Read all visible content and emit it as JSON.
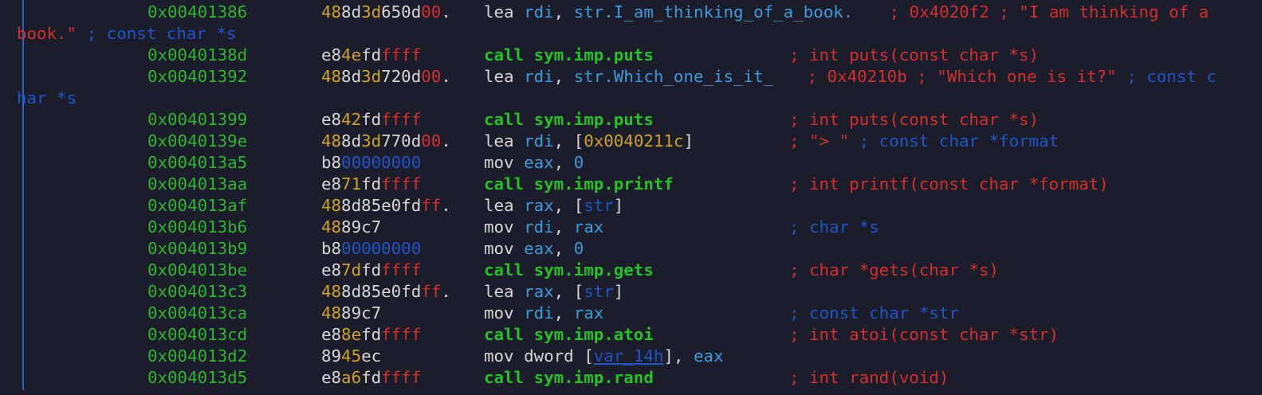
{
  "colors": {
    "background": "#1c1d2a",
    "address": "#2fb52f",
    "call": "#28c028",
    "comment": "#d3302f",
    "register": "#3f9bdc",
    "type_keyword": "#1f55c9",
    "byte_yellow": "#cfa22a",
    "gutter": "#2a63c6"
  },
  "lines": [
    {
      "addr": "0x00401386",
      "bytes": [
        [
          "48",
          "yellow"
        ],
        [
          "8d",
          "white"
        ],
        [
          "3d",
          "yellow"
        ],
        [
          "650d",
          "white"
        ],
        [
          "00",
          "red"
        ],
        [
          ".",
          "white"
        ]
      ],
      "ins": [
        [
          "lea ",
          "white"
        ],
        [
          "rdi",
          "blue"
        ],
        [
          ", ",
          "white"
        ],
        [
          "str.I_am_thinking_of_a_book.",
          "blue"
        ]
      ],
      "cmt": [
        [
          " ; 0x4020f2 ; \"I am thinking of a",
          "red"
        ]
      ]
    },
    {
      "cont": [
        [
          "book.\"",
          "red"
        ],
        [
          " ; const char *s",
          "dblue"
        ]
      ]
    },
    {
      "addr": "0x0040138d",
      "bytes": [
        [
          "e8",
          "white"
        ],
        [
          "4e",
          "yellow"
        ],
        [
          "fd",
          "white"
        ],
        [
          "ffff",
          "red"
        ]
      ],
      "ins": [
        [
          "call sym.imp.puts",
          "green"
        ]
      ],
      "cmt": [
        [
          "; int puts(const char *s)",
          "red"
        ]
      ]
    },
    {
      "addr": "0x00401392",
      "bytes": [
        [
          "48",
          "yellow"
        ],
        [
          "8d",
          "white"
        ],
        [
          "3d",
          "yellow"
        ],
        [
          "720d",
          "white"
        ],
        [
          "00",
          "red"
        ],
        [
          ".",
          "white"
        ]
      ],
      "ins": [
        [
          "lea ",
          "white"
        ],
        [
          "rdi",
          "blue"
        ],
        [
          ", ",
          "white"
        ],
        [
          "str.Which_one_is_it_",
          "blue"
        ]
      ],
      "cmt": [
        [
          " ; 0x40210b ; \"Which one is it?\"",
          "red"
        ],
        [
          " ; const c",
          "dblue"
        ]
      ]
    },
    {
      "cont": [
        [
          "har *s",
          "dblue"
        ]
      ]
    },
    {
      "addr": "0x00401399",
      "bytes": [
        [
          "e8",
          "white"
        ],
        [
          "42",
          "yellow"
        ],
        [
          "fd",
          "white"
        ],
        [
          "ffff",
          "red"
        ]
      ],
      "ins": [
        [
          "call sym.imp.puts",
          "green"
        ]
      ],
      "cmt": [
        [
          "; int puts(const char *s)",
          "red"
        ]
      ]
    },
    {
      "addr": "0x0040139e",
      "bytes": [
        [
          "48",
          "yellow"
        ],
        [
          "8d",
          "white"
        ],
        [
          "3d",
          "yellow"
        ],
        [
          "770d",
          "white"
        ],
        [
          "00",
          "red"
        ],
        [
          ".",
          "white"
        ]
      ],
      "ins": [
        [
          "lea ",
          "white"
        ],
        [
          "rdi",
          "blue"
        ],
        [
          ", [",
          "white"
        ],
        [
          "0x0040211c",
          "yellow"
        ],
        [
          "]",
          "white"
        ]
      ],
      "cmt": [
        [
          "; \"> \"",
          "red"
        ],
        [
          " ; const char *format",
          "dblue"
        ]
      ]
    },
    {
      "addr": "0x004013a5",
      "bytes": [
        [
          "b8",
          "white"
        ],
        [
          "00000000",
          "dblue"
        ]
      ],
      "ins": [
        [
          "mov ",
          "white"
        ],
        [
          "eax",
          "blue"
        ],
        [
          ", ",
          "white"
        ],
        [
          "0",
          "blue"
        ]
      ],
      "cmt": []
    },
    {
      "addr": "0x004013aa",
      "bytes": [
        [
          "e8",
          "white"
        ],
        [
          "71",
          "yellow"
        ],
        [
          "fd",
          "white"
        ],
        [
          "ffff",
          "red"
        ]
      ],
      "ins": [
        [
          "call sym.imp.printf",
          "green"
        ]
      ],
      "cmt": [
        [
          "; int printf(const char *format)",
          "red"
        ]
      ]
    },
    {
      "addr": "0x004013af",
      "bytes": [
        [
          "48",
          "yellow"
        ],
        [
          "8d85e0fd",
          "white"
        ],
        [
          "ff",
          "red"
        ],
        [
          ".",
          "white"
        ]
      ],
      "ins": [
        [
          "lea ",
          "white"
        ],
        [
          "rax",
          "blue"
        ],
        [
          ", [",
          "white"
        ],
        [
          "str",
          "dblue"
        ],
        [
          "]",
          "white"
        ]
      ],
      "cmt": []
    },
    {
      "addr": "0x004013b6",
      "bytes": [
        [
          "48",
          "yellow"
        ],
        [
          "89c7",
          "white"
        ]
      ],
      "ins": [
        [
          "mov ",
          "white"
        ],
        [
          "rdi",
          "blue"
        ],
        [
          ", ",
          "white"
        ],
        [
          "rax",
          "blue"
        ]
      ],
      "cmt": [
        [
          "; char *s",
          "dblue"
        ]
      ]
    },
    {
      "addr": "0x004013b9",
      "bytes": [
        [
          "b8",
          "white"
        ],
        [
          "00000000",
          "dblue"
        ]
      ],
      "ins": [
        [
          "mov ",
          "white"
        ],
        [
          "eax",
          "blue"
        ],
        [
          ", ",
          "white"
        ],
        [
          "0",
          "blue"
        ]
      ],
      "cmt": []
    },
    {
      "addr": "0x004013be",
      "bytes": [
        [
          "e8",
          "white"
        ],
        [
          "7d",
          "yellow"
        ],
        [
          "fd",
          "white"
        ],
        [
          "ffff",
          "red"
        ]
      ],
      "ins": [
        [
          "call sym.imp.gets",
          "green"
        ]
      ],
      "cmt": [
        [
          "; char *gets(char *s)",
          "red"
        ]
      ]
    },
    {
      "addr": "0x004013c3",
      "bytes": [
        [
          "48",
          "yellow"
        ],
        [
          "8d85e0fd",
          "white"
        ],
        [
          "ff",
          "red"
        ],
        [
          ".",
          "white"
        ]
      ],
      "ins": [
        [
          "lea ",
          "white"
        ],
        [
          "rax",
          "blue"
        ],
        [
          ", [",
          "white"
        ],
        [
          "str",
          "dblue"
        ],
        [
          "]",
          "white"
        ]
      ],
      "cmt": []
    },
    {
      "addr": "0x004013ca",
      "bytes": [
        [
          "48",
          "yellow"
        ],
        [
          "89c7",
          "white"
        ]
      ],
      "ins": [
        [
          "mov ",
          "white"
        ],
        [
          "rdi",
          "blue"
        ],
        [
          ", ",
          "white"
        ],
        [
          "rax",
          "blue"
        ]
      ],
      "cmt": [
        [
          "; const char *str",
          "dblue"
        ]
      ]
    },
    {
      "addr": "0x004013cd",
      "bytes": [
        [
          "e8",
          "white"
        ],
        [
          "8e",
          "yellow"
        ],
        [
          "fd",
          "white"
        ],
        [
          "ffff",
          "red"
        ]
      ],
      "ins": [
        [
          "call sym.imp.atoi",
          "green"
        ]
      ],
      "cmt": [
        [
          "; int atoi(const char *str)",
          "red"
        ]
      ]
    },
    {
      "addr": "0x004013d2",
      "bytes": [
        [
          "89",
          "white"
        ],
        [
          "45",
          "yellow"
        ],
        [
          "ec",
          "white"
        ]
      ],
      "ins": [
        [
          "mov dword [",
          "white"
        ],
        [
          "var_14h",
          "dblue-u"
        ],
        [
          "], ",
          "white"
        ],
        [
          "eax",
          "blue"
        ]
      ],
      "cmt": []
    },
    {
      "addr": "0x004013d5",
      "bytes": [
        [
          "e8",
          "white"
        ],
        [
          "a6",
          "yellow"
        ],
        [
          "fd",
          "white"
        ],
        [
          "ffff",
          "red"
        ]
      ],
      "ins": [
        [
          "call sym.imp.rand",
          "green"
        ]
      ],
      "cmt": [
        [
          "; int rand(void)",
          "red"
        ]
      ]
    }
  ]
}
